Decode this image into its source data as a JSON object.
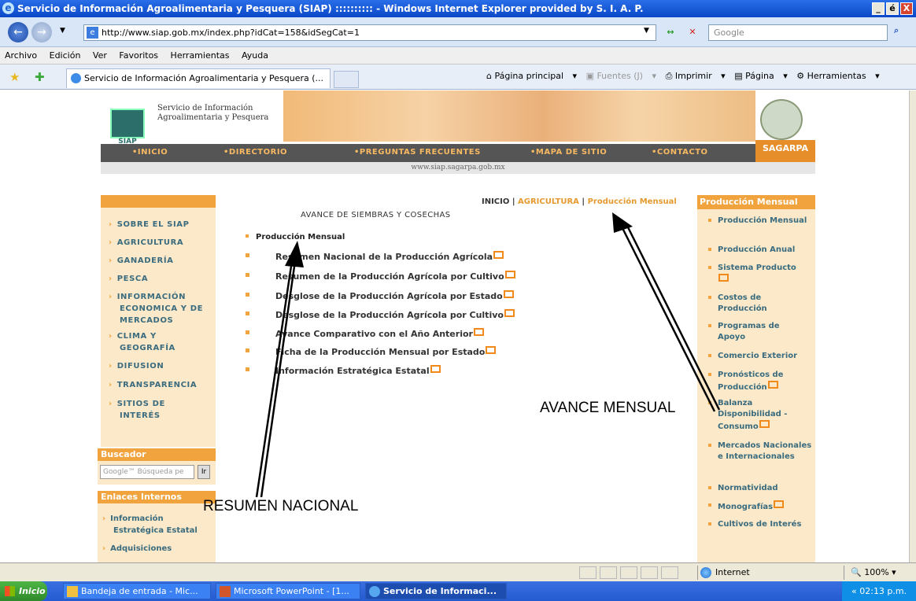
{
  "window": {
    "title": "Servicio de Información Agroalimentaria y Pesquera (SIAP) :::::::::: - Windows Internet Explorer provided by S. I. A. P.",
    "min": "_",
    "max": "é",
    "close": "X"
  },
  "toolbar": {
    "back": "←",
    "forward": "→",
    "url": "http://www.siap.gob.mx/index.php?idCat=158&idSegCat=1",
    "refresh": "↔",
    "stop": "✕",
    "search_placeholder": "Google"
  },
  "menu": [
    "Archivo",
    "Edición",
    "Ver",
    "Favoritos",
    "Herramientas",
    "Ayuda"
  ],
  "tabs": {
    "active_tab": "Servicio de Información Agroalimentaria y Pesquera (...",
    "commands": [
      "Página principal",
      "Fuentes (J)",
      "Imprimir",
      "Página",
      "Herramientas"
    ]
  },
  "site": {
    "logo_text": "SIAP",
    "name_line1": "Servicio de Información",
    "name_line2": "Agroalimentaria y Pesquera",
    "nav": [
      "Inicio",
      "Directorio",
      "Preguntas Frecuentes",
      "Mapa de Sitio",
      "Contacto"
    ],
    "sagarpa": "SAGARPA",
    "url_strip": "www.siap.sagarpa.gob.mx"
  },
  "left_nav": [
    "SOBRE EL SIAP",
    "AGRICULTURA",
    "GANADERÍA",
    "PESCA",
    "INFORMACIÓN ECONOMICA Y DE MERCADOS",
    "CLIMA Y GEOGRAFÍA",
    "DIFUSION",
    "TRANSPARENCIA",
    "SITIOS DE INTERÉS"
  ],
  "buscador": {
    "title": "Buscador",
    "placeholder": "Google™ Búsqueda pe",
    "go": "Ir"
  },
  "enlaces": {
    "title": "Enlaces Internos",
    "items": [
      "Información Estratégica Estatal",
      "Adquisiciones"
    ]
  },
  "breadcrumb": {
    "home": "INICIO",
    "sep": "|",
    "section": "AGRICULTURA",
    "current": "Producción Mensual"
  },
  "main": {
    "heading": "AVANCE DE SIEMBRAS Y COSECHAS",
    "section": "Producción Mensual",
    "links": [
      "Resumen Nacional de la Producción Agrícola",
      "Resumen de la Producción Agrícola por Cultivo",
      "Desglose de la Producción Agrícola por Estado",
      "Desglose de la Producción Agrícola por Cultivo",
      "Avance Comparativo con el Año Anterior",
      "Ficha de la Producción Mensual por Estado",
      "Información Estratégica Estatal"
    ]
  },
  "right_col": {
    "title": "Producción Mensual",
    "items": [
      "Producción Mensual",
      "Producción Anual",
      "Sistema Producto",
      "Costos de Producción",
      "Programas de Apoyo",
      "Comercio Exterior",
      "Pronósticos de Producción",
      "Balanza Disponibilidad - Consumo",
      "Mercados Nacionales e Internacionales",
      "Normatividad",
      "Monografías",
      "Cultivos de Interés"
    ]
  },
  "annotations": {
    "avance": "AVANCE MENSUAL",
    "resumen": "RESUMEN NACIONAL"
  },
  "status": {
    "zone": "Internet",
    "zoom": "100%"
  },
  "taskbar": {
    "start": "Inicio",
    "tasks": [
      "Bandeja de entrada - Mic...",
      "Microsoft PowerPoint - [1...",
      "Servicio de Informaci..."
    ],
    "clock": "02:13 p.m."
  }
}
